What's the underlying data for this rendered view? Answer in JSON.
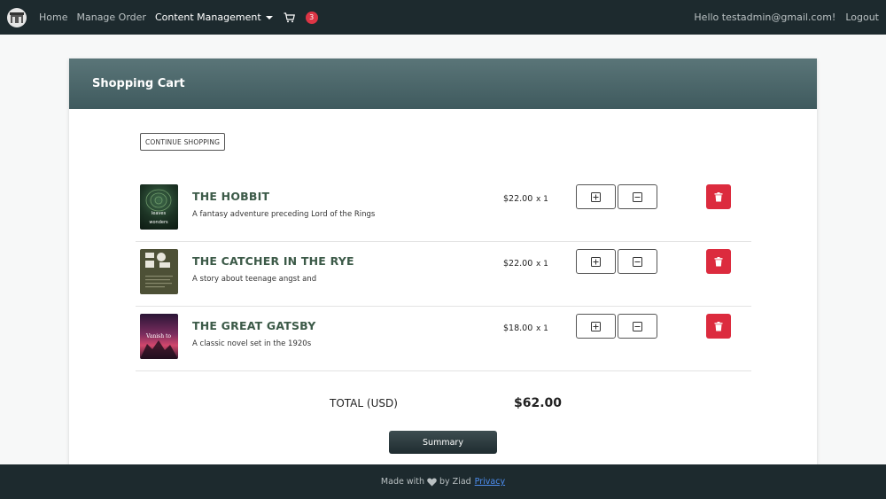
{
  "navbar": {
    "brand_icon": "store-logo-icon",
    "links": [
      "Home",
      "Manage Order",
      "Content Management"
    ],
    "cart_icon": "cart-icon",
    "cart_count": "3",
    "greeting": "Hello testadmin@gmail.com!",
    "logout": "Logout"
  },
  "cart": {
    "title": "Shopping Cart",
    "continue_label": "CONTINUE SHOPPING",
    "items": [
      {
        "title": "THE HOBBIT",
        "description": "A fantasy adventure preceding Lord of the Rings",
        "price": "$22.00",
        "qty": "x 1",
        "cover_text_top": "leaves",
        "cover_text_bottom": "wonders"
      },
      {
        "title": "THE CATCHER IN THE RYE",
        "description": "A story about teenage angst and",
        "price": "$22.00",
        "qty": "x 1"
      },
      {
        "title": "THE GREAT GATSBY",
        "description": "A classic novel set in the 1920s",
        "price": "$18.00",
        "qty": "x 1",
        "cover_text": "Vanish to"
      }
    ],
    "total_label": "TOTAL (USD)",
    "total_value": "$62.00",
    "summary_label": "Summary"
  },
  "footer": {
    "text_before": "Made with",
    "heart_icon": "heart-icon",
    "text_after": "by Ziad",
    "privacy": "Privacy"
  },
  "colors": {
    "navbar_bg": "#1d2a2e",
    "header_bg": "#4a6568",
    "title_green": "#3c5a48",
    "delete_red": "#dc2b3e",
    "badge_red": "#dc3545",
    "link_blue": "#4d8ef0"
  }
}
